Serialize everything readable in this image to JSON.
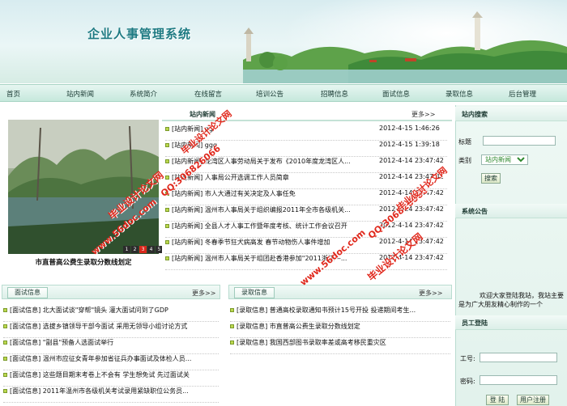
{
  "header": {
    "site_title": "企业人事管理系统"
  },
  "nav": {
    "items": [
      "首页",
      "站内新闻",
      "系统简介",
      "在线留言",
      "培训公告",
      "招聘信息",
      "面试信息",
      "录取信息",
      "后台管理"
    ]
  },
  "news": {
    "title": "站内新闻",
    "more": "更多>>",
    "rows": [
      {
        "text": "[站内新闻] gg",
        "date": "2012-4-15 1:46:26"
      },
      {
        "text": "[站内新闻] ggg",
        "date": "2012-4-15 1:39:18"
      },
      {
        "text": "[站内新闻] 龙湾区人事劳动局关于发布《2010年度龙湾区人...",
        "date": "2012-4-14 23:47:42"
      },
      {
        "text": "[站内新闻] 人事局公开选调工作人员简章",
        "date": "2012-4-14 23:47:42"
      },
      {
        "text": "[站内新闻] 市人大通过有关决定及人事任免",
        "date": "2012-4-14 23:47:42"
      },
      {
        "text": "[站内新闻] 温州市人事局关于组织编报2011年全市各级机关...",
        "date": "2012-4-14 23:47:42"
      },
      {
        "text": "[站内新闻] 全县人才人事工作暨年度考核、统计工作会议召开",
        "date": "2012-4-14 23:47:42"
      },
      {
        "text": "[站内新闻] 冬春季节狂犬病高发  春节动物伤人事件增加",
        "date": "2012-4-14 23:47:42"
      },
      {
        "text": "[站内新闻] 温州市人事局关于组团赴香港参加\"2011浙江—...",
        "date": "2012-4-14 23:47:42"
      }
    ]
  },
  "photo": {
    "caption": "市直普高公费生录取分数线划定",
    "thumbs": [
      "1",
      "2",
      "3",
      "4",
      "5"
    ]
  },
  "interview": {
    "title": "面试信息",
    "more": "更多>>",
    "rows": [
      "[面试信息] 北大面试谈\"穿帮\"镜头  灌大面试问到了GDP",
      "[面试信息] 选拔乡镇领导干部今面试  采用无领导小组讨论方式",
      "[面试信息] \"副县\"预备人选面试举行",
      "[面试信息] 温州市应征女青年参加省征兵办事面试及体检人员...",
      "[面试信息] 这些题目期末考卷上不会有  学生想免试  先过面试关",
      "[面试信息] 2011年温州市各级机关考试录用紧缺职位公务员..."
    ]
  },
  "admission": {
    "title": "录取信息",
    "more": "更多>>",
    "rows": [
      "[录取信息] 普通高校录取通知书预计15号开投  投递期间考生...",
      "[录取信息] 市直普高公费生录取分数线划定",
      "[录取信息] 我国西部图书录取率差或高考移民重灾区"
    ]
  },
  "search": {
    "title": "站内搜索",
    "title_label": "标题",
    "category_label": "类别",
    "category_value": "站内新闻",
    "button": "搜索"
  },
  "announcement": {
    "title": "系统公告",
    "text": "欢迎大家登陆我站，我站主要是为广大朋友精心制作的一个"
  },
  "login": {
    "title": "员工登陆",
    "id_label": "工号:",
    "password_label": "密码:",
    "login_button": "登 陆",
    "register_button": "用户注册"
  },
  "watermarks": [
    "毕业设计论文网",
    "www.56doc.com",
    "QQ:306826066"
  ],
  "colors": {
    "accent": "#1d7a82",
    "nav_bg": "#c6e8dc",
    "watermark": "#e0281c"
  }
}
